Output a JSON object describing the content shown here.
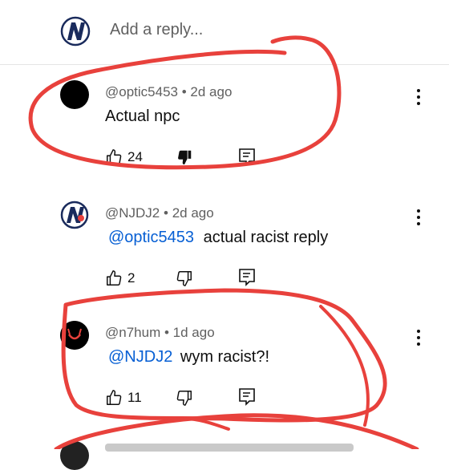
{
  "reply_bar": {
    "placeholder": "Add a reply..."
  },
  "comments": [
    {
      "handle": "@optic5453",
      "time": "2d ago",
      "text": "Actual npc",
      "likes": "24",
      "disliked": true
    },
    {
      "handle": "@NJDJ2",
      "time": "2d ago",
      "mention": "@optic5453",
      "text": "actual racist reply",
      "likes": "2",
      "disliked": false
    },
    {
      "handle": "@n7hum",
      "time": "1d ago",
      "mention": "@NJDJ2",
      "text": "wym racist?!",
      "likes": "11",
      "disliked": false
    }
  ],
  "colors": {
    "annotation": "#e8413c",
    "link": "#065fd4",
    "meta": "#606060",
    "logo_navy": "#1a2b5c"
  }
}
